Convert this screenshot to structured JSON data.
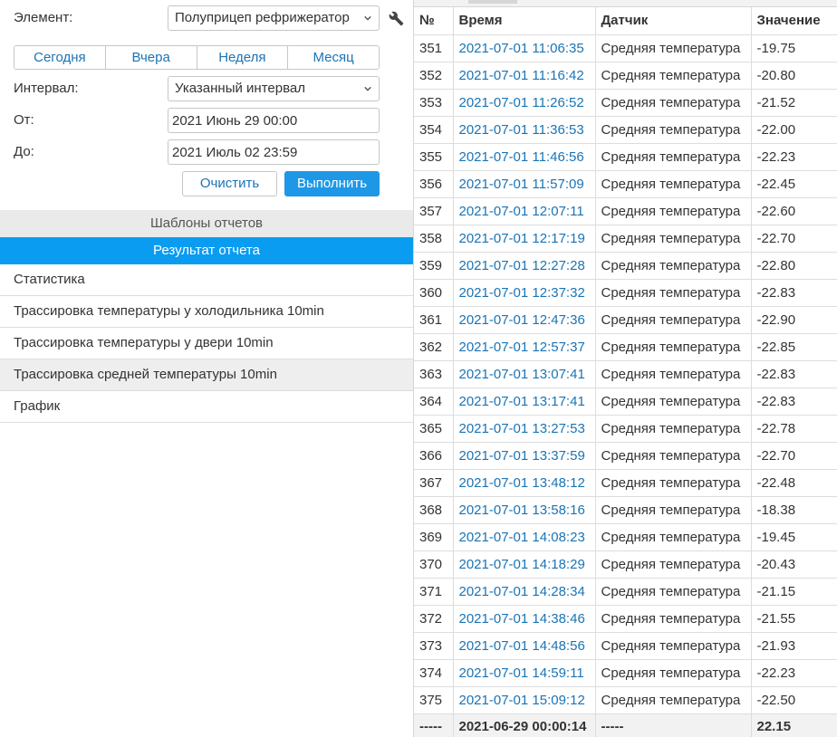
{
  "form": {
    "element_label": "Элемент:",
    "element_value": "Полуприцеп рефрижератор",
    "interval_label": "Интервал:",
    "interval_value": "Указанный интервал",
    "from_label": "От:",
    "from_value": "2021 Июнь 29 00:00",
    "to_label": "До:",
    "to_value": "2021 Июль 02 23:59",
    "periods": [
      "Сегодня",
      "Вчера",
      "Неделя",
      "Месяц"
    ],
    "clear_label": "Очистить",
    "run_label": "Выполнить"
  },
  "icons": {
    "wrench": "wrench-icon",
    "chevron": "chevron-down-icon"
  },
  "colors": {
    "accent": "#0a9cf1",
    "button_primary": "#1e98e6",
    "link": "#1a74b5"
  },
  "sections": {
    "templates": "Шаблоны отчетов",
    "results": "Результат отчета"
  },
  "reports": [
    "Статистика",
    "Трассировка температуры у холодильника 10min",
    "Трассировка температуры у двери 10min",
    "Трассировка средней температуры 10min",
    "График"
  ],
  "active_report_index": 3,
  "table": {
    "headers": [
      "№",
      "Время",
      "Датчик",
      "Значение"
    ],
    "rows": [
      [
        "351",
        "2021-07-01 11:06:35",
        "Средняя температура",
        "-19.75"
      ],
      [
        "352",
        "2021-07-01 11:16:42",
        "Средняя температура",
        "-20.80"
      ],
      [
        "353",
        "2021-07-01 11:26:52",
        "Средняя температура",
        "-21.52"
      ],
      [
        "354",
        "2021-07-01 11:36:53",
        "Средняя температура",
        "-22.00"
      ],
      [
        "355",
        "2021-07-01 11:46:56",
        "Средняя температура",
        "-22.23"
      ],
      [
        "356",
        "2021-07-01 11:57:09",
        "Средняя температура",
        "-22.45"
      ],
      [
        "357",
        "2021-07-01 12:07:11",
        "Средняя температура",
        "-22.60"
      ],
      [
        "358",
        "2021-07-01 12:17:19",
        "Средняя температура",
        "-22.70"
      ],
      [
        "359",
        "2021-07-01 12:27:28",
        "Средняя температура",
        "-22.80"
      ],
      [
        "360",
        "2021-07-01 12:37:32",
        "Средняя температура",
        "-22.83"
      ],
      [
        "361",
        "2021-07-01 12:47:36",
        "Средняя температура",
        "-22.90"
      ],
      [
        "362",
        "2021-07-01 12:57:37",
        "Средняя температура",
        "-22.85"
      ],
      [
        "363",
        "2021-07-01 13:07:41",
        "Средняя температура",
        "-22.83"
      ],
      [
        "364",
        "2021-07-01 13:17:41",
        "Средняя температура",
        "-22.83"
      ],
      [
        "365",
        "2021-07-01 13:27:53",
        "Средняя температура",
        "-22.78"
      ],
      [
        "366",
        "2021-07-01 13:37:59",
        "Средняя температура",
        "-22.70"
      ],
      [
        "367",
        "2021-07-01 13:48:12",
        "Средняя температура",
        "-22.48"
      ],
      [
        "368",
        "2021-07-01 13:58:16",
        "Средняя температура",
        "-18.38"
      ],
      [
        "369",
        "2021-07-01 14:08:23",
        "Средняя температура",
        "-19.45"
      ],
      [
        "370",
        "2021-07-01 14:18:29",
        "Средняя температура",
        "-20.43"
      ],
      [
        "371",
        "2021-07-01 14:28:34",
        "Средняя температура",
        "-21.15"
      ],
      [
        "372",
        "2021-07-01 14:38:46",
        "Средняя температура",
        "-21.55"
      ],
      [
        "373",
        "2021-07-01 14:48:56",
        "Средняя температура",
        "-21.93"
      ],
      [
        "374",
        "2021-07-01 14:59:11",
        "Средняя температура",
        "-22.23"
      ],
      [
        "375",
        "2021-07-01 15:09:12",
        "Средняя температура",
        "-22.50"
      ]
    ],
    "footer": [
      "-----",
      "2021-06-29 00:00:14",
      "-----",
      "22.15"
    ]
  }
}
